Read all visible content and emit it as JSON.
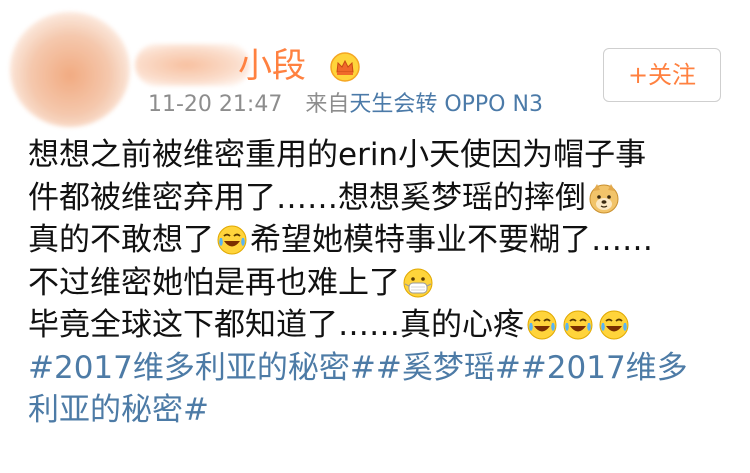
{
  "header": {
    "username": "小段",
    "timestamp": "11-20 21:47",
    "source_label": "来自",
    "source_app": "天生会转 OPPO N3",
    "follow_label": "+关注"
  },
  "icons": {
    "crown": "crown-icon",
    "emojis": [
      "doge-emoji",
      "laugh-cry-emoji",
      "mask-emoji"
    ]
  },
  "post": {
    "lines": [
      "想想之前被维密重用的erin小天使因为帽子事",
      "件都被维密弃用了……想想奚梦瑶的摔倒",
      "真的不敢想了",
      "希望她模特事业不要糊了……",
      "不过维密她怕是再也难上了",
      "毕竟全球这下都知道了……真的心疼"
    ],
    "topics": [
      "#2017维多利亚的秘密#",
      "#奚梦瑶#",
      "#2017维多",
      "利亚的秘密#"
    ]
  },
  "colors": {
    "username": "#ff8140",
    "topic": "#4d7ba6",
    "meta": "#8d8d8d",
    "text": "#111111"
  }
}
